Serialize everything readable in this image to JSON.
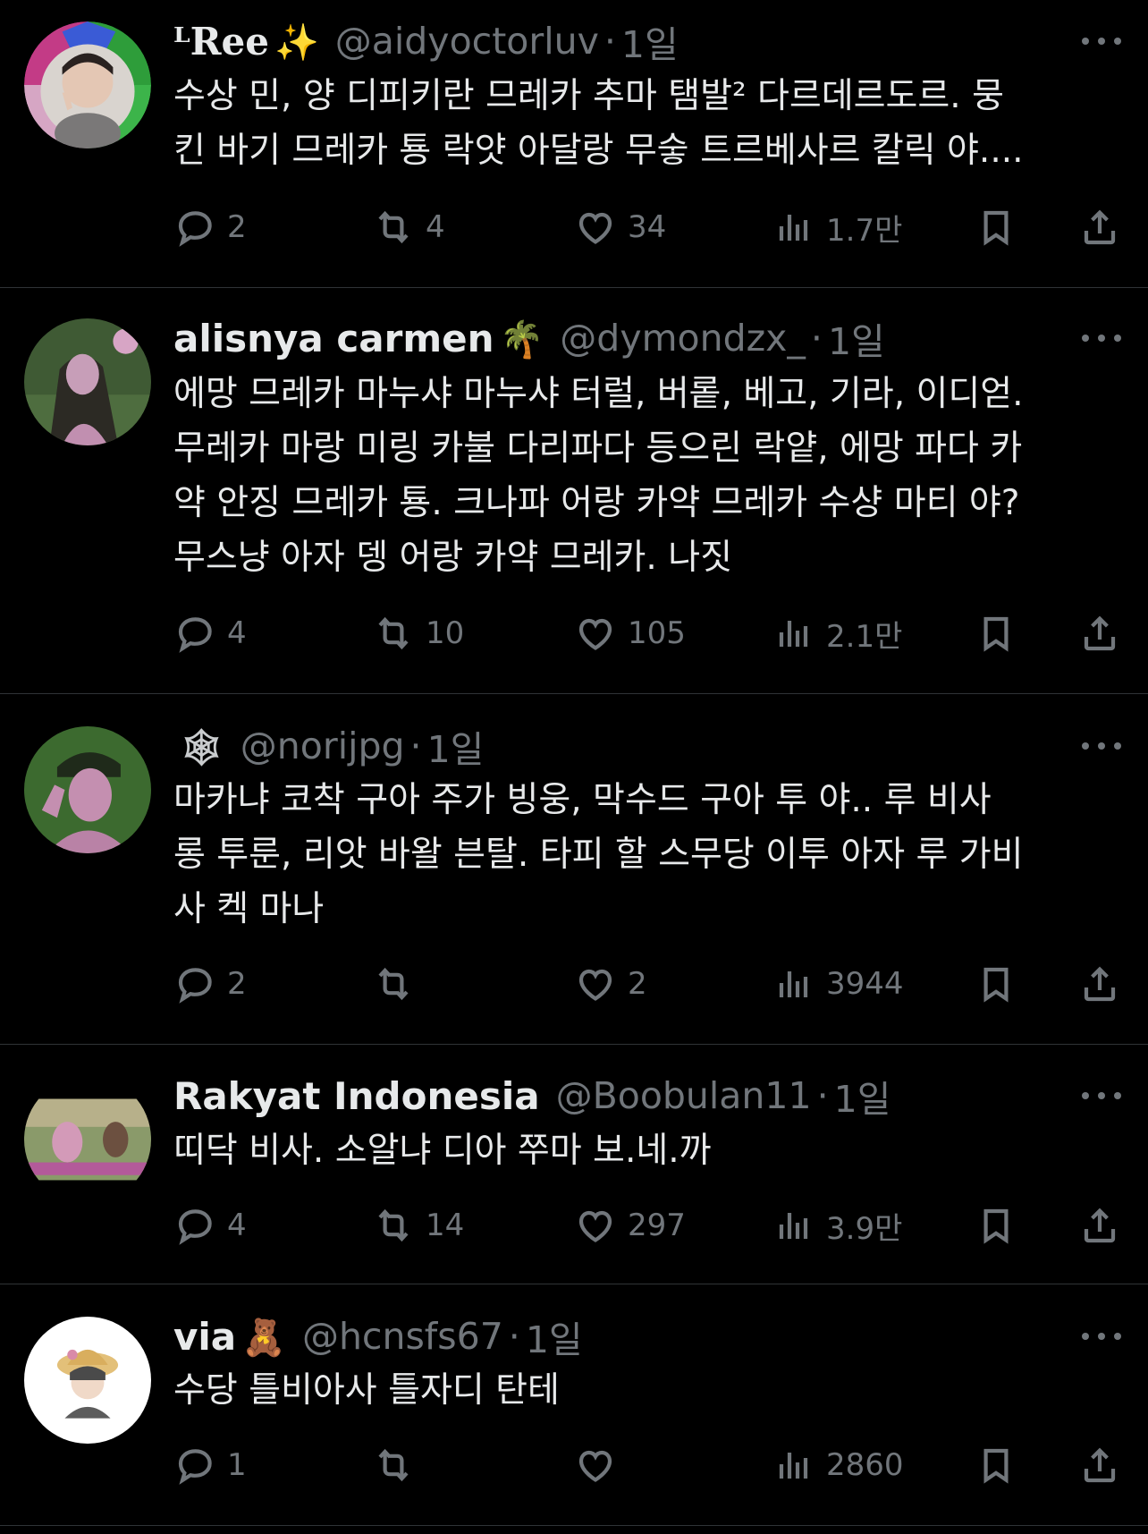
{
  "tweets": [
    {
      "name": "ᴸRee",
      "name_emoji": "✨",
      "handle": "@aidyoctorluv",
      "dot": "·",
      "time": "1일",
      "lines": [
        "수상 민, 양 디피키란 므레카 추마 탬발² 다르데르도르. 뭉",
        "킨 바기 므레카 툥 락얏 아달랑 무숳 트르베사르 칼릭 야...."
      ],
      "replies": "2",
      "retweets": "4",
      "likes": "34",
      "views": "1.7만"
    },
    {
      "name": "alisnya carmen",
      "name_emoji": "🌴",
      "handle": "@dymondzx_",
      "dot": "·",
      "time": "1일",
      "lines": [
        "에망 므레카 마누샤 마누샤 터럴, 버롵, 베고, 기라, 이디얻.",
        "무레카 마랑 미링 카불 다리파다 등으린 락얕, 에망 파다 카",
        "약 안징 므레카 툥. 크나파 어랑 카약 므레카 수샹 마티 야?",
        "무스냥 아자 뎅 어랑 카약 므레카. 나짓"
      ],
      "replies": "4",
      "retweets": "10",
      "likes": "105",
      "views": "2.1만"
    },
    {
      "name": "",
      "name_emoji": "🕸",
      "handle": "@norijpg",
      "dot": "·",
      "time": "1일",
      "lines": [
        "마카냐 코착 구아 주가 빙웅, 막수드 구아 투 야.. 루 비사",
        "롱 투룬, 리앗 바왈 븐탈. 타피 할 스무당 이투 아자 루 가비",
        "사 켁 마나"
      ],
      "replies": "2",
      "retweets": "",
      "likes": "2",
      "views": "3944"
    },
    {
      "name": "Rakyat Indonesia",
      "name_emoji": "",
      "handle": "@Boobulan11",
      "dot": "·",
      "time": "1일",
      "lines": [
        "띠닥 비사. 소알냐 디아 쭈마 보.네.까"
      ],
      "replies": "4",
      "retweets": "14",
      "likes": "297",
      "views": "3.9만"
    },
    {
      "name": "via",
      "name_emoji": "🧸",
      "handle": "@hcnsfs67",
      "dot": "·",
      "time": "1일",
      "lines": [
        "수당 틀비아사 틀자디 탄테"
      ],
      "replies": "1",
      "retweets": "",
      "likes": "",
      "views": "2860"
    }
  ],
  "icons": {
    "reply": "reply-icon",
    "retweet": "retweet-icon",
    "like": "heart-icon",
    "views": "views-chart-icon",
    "bookmark": "bookmark-icon",
    "share": "share-icon",
    "more": "more-dots-icon"
  },
  "colors": {
    "background": "#000000",
    "text": "#e7e9ea",
    "secondary": "#71767b",
    "divider": "#2f3336"
  }
}
